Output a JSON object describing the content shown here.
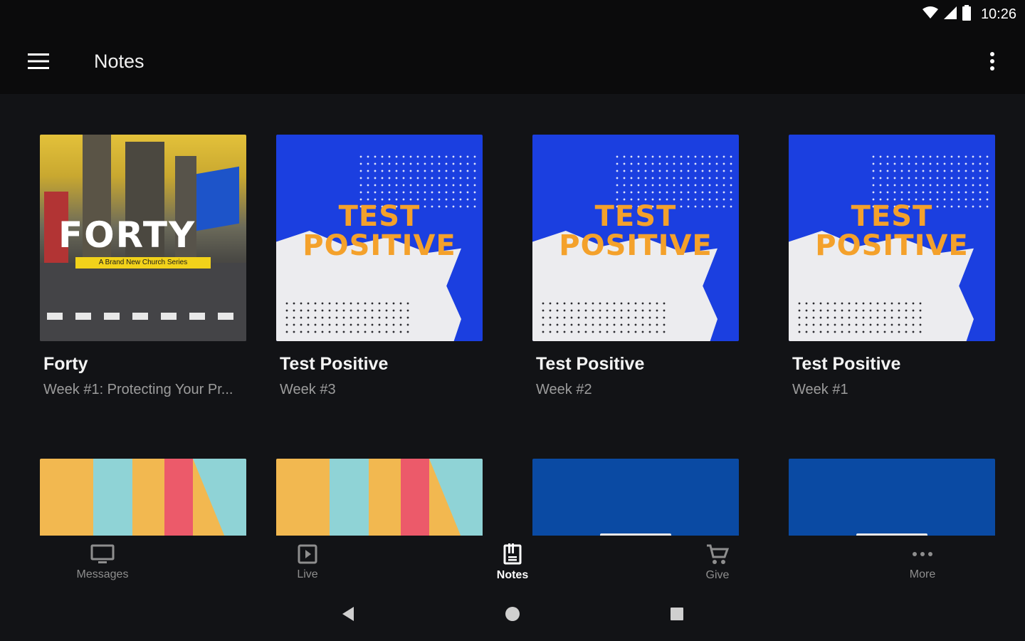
{
  "status_bar": {
    "time": "10:26"
  },
  "app_bar": {
    "title": "Notes"
  },
  "cards": [
    {
      "title": "Forty",
      "subtitle": "Week #1: Protecting Your Pr...",
      "art_word": "FORTY",
      "art_tag": "A Brand New Church Series"
    },
    {
      "title": "Test Positive",
      "subtitle": "Week #3",
      "art_line1": "TEST",
      "art_line2": "POSITIVE"
    },
    {
      "title": "Test Positive",
      "subtitle": "Week #2",
      "art_line1": "TEST",
      "art_line2": "POSITIVE"
    },
    {
      "title": "Test Positive",
      "subtitle": "Week #1",
      "art_line1": "TEST",
      "art_line2": "POSITIVE"
    }
  ],
  "bottom_nav": {
    "items": [
      {
        "label": "Messages",
        "icon": "monitor-icon"
      },
      {
        "label": "Live",
        "icon": "play-icon"
      },
      {
        "label": "Notes",
        "icon": "notes-icon",
        "active": true
      },
      {
        "label": "Give",
        "icon": "cart-icon"
      },
      {
        "label": "More",
        "icon": "more-horizontal-icon"
      }
    ]
  },
  "colors": {
    "background": "#121316",
    "app_bar": "#0b0b0c",
    "accent_orange": "#f4a12b",
    "art_blue": "#1b3fe0",
    "inactive": "#8e8e8e"
  }
}
